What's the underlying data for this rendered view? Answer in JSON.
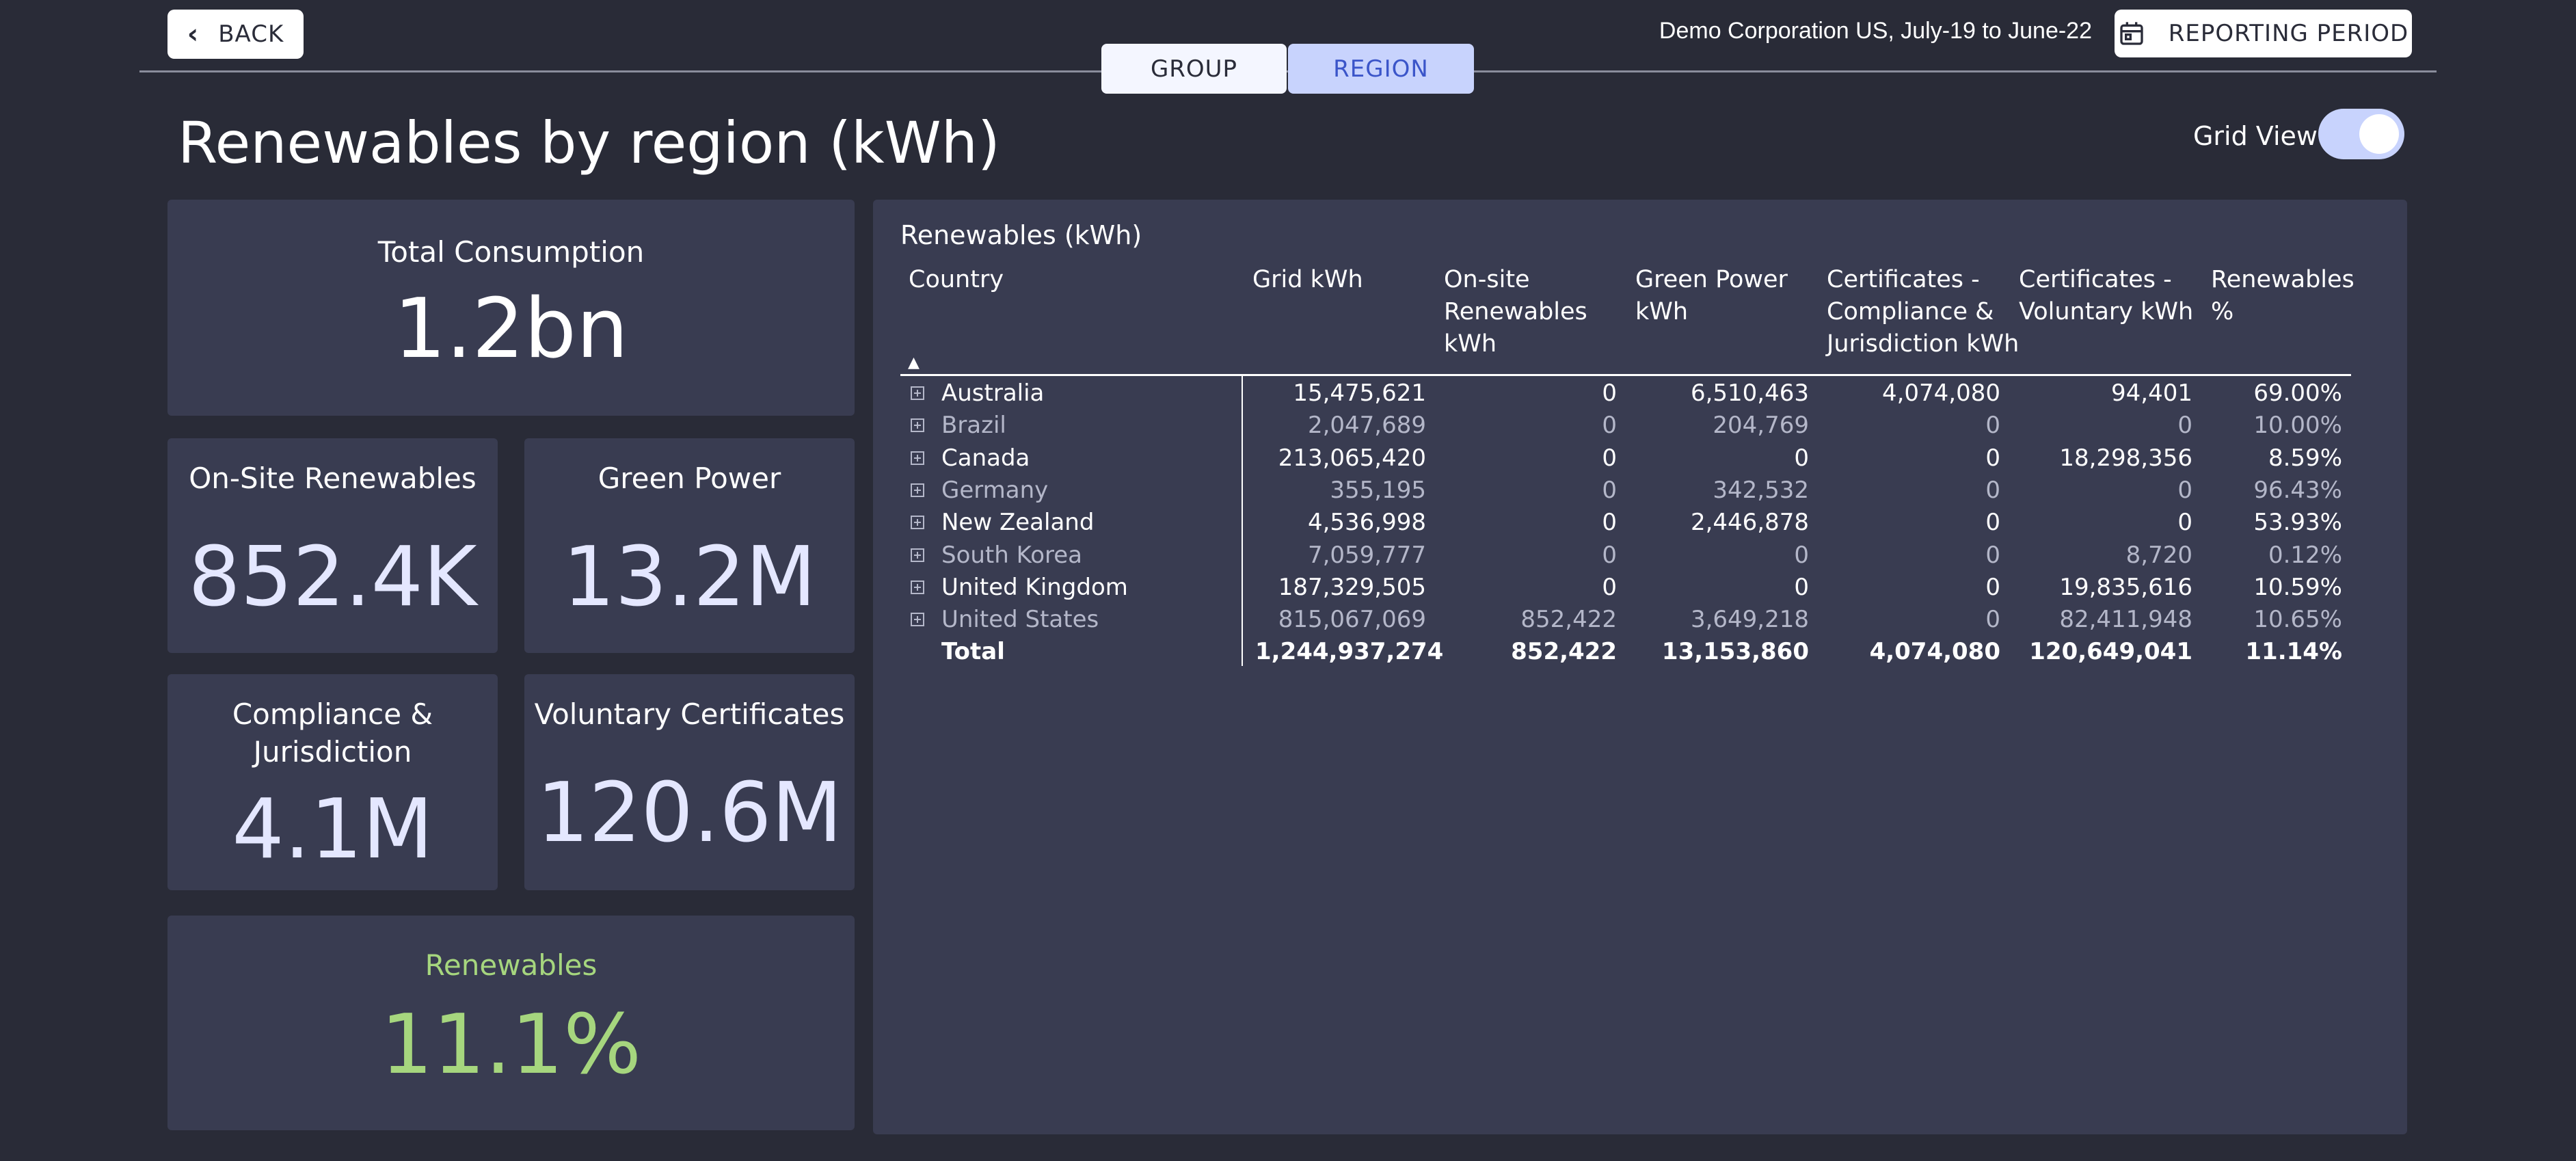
{
  "header": {
    "back_label": "BACK",
    "tabs": [
      {
        "label": "GROUP",
        "selected": false
      },
      {
        "label": "REGION",
        "selected": true
      }
    ],
    "company_period": "Demo Corporation US, July-19 to June-22",
    "reporting_period_label": "REPORTING PERIOD"
  },
  "page": {
    "title": "Renewables by region (kWh)",
    "grid_view_label": "Grid View",
    "grid_view_on": true
  },
  "cards": {
    "total": {
      "label": "Total Consumption",
      "value": "1.2bn"
    },
    "onsite": {
      "label": "On-Site Renewables",
      "value": "852.4K"
    },
    "green": {
      "label": "Green Power",
      "value": "13.2M"
    },
    "compliance": {
      "label_line1": "Compliance &",
      "label_line2": "Jurisdiction",
      "value": "4.1M"
    },
    "voluntary": {
      "label": "Voluntary Certificates",
      "value": "120.6M"
    },
    "renewables": {
      "label": "Renewables",
      "value": "11.1%",
      "accent": "#a6d67e"
    }
  },
  "table": {
    "title": "Renewables (kWh)",
    "sort_indicator": "▲",
    "columns": [
      {
        "line1": "Country",
        "line2": "",
        "line3": ""
      },
      {
        "line1": "Grid kWh",
        "line2": "",
        "line3": ""
      },
      {
        "line1": "On-site",
        "line2": "Renewables",
        "line3": "kWh"
      },
      {
        "line1": "Green Power",
        "line2": "kWh",
        "line3": ""
      },
      {
        "line1": "Certificates -",
        "line2": "Compliance &",
        "line3": "Jurisdiction kWh"
      },
      {
        "line1": "Certificates -",
        "line2": "Voluntary kWh",
        "line3": ""
      },
      {
        "line1": "Renewables",
        "line2": "%",
        "line3": ""
      }
    ],
    "rows": [
      {
        "country": "Australia",
        "grid": "15,475,621",
        "onsite": "0",
        "green": "6,510,463",
        "compliance": "4,074,080",
        "voluntary": "94,401",
        "pct": "69.00%"
      },
      {
        "country": "Brazil",
        "grid": "2,047,689",
        "onsite": "0",
        "green": "204,769",
        "compliance": "0",
        "voluntary": "0",
        "pct": "10.00%"
      },
      {
        "country": "Canada",
        "grid": "213,065,420",
        "onsite": "0",
        "green": "0",
        "compliance": "0",
        "voluntary": "18,298,356",
        "pct": "8.59%"
      },
      {
        "country": "Germany",
        "grid": "355,195",
        "onsite": "0",
        "green": "342,532",
        "compliance": "0",
        "voluntary": "0",
        "pct": "96.43%"
      },
      {
        "country": "New Zealand",
        "grid": "4,536,998",
        "onsite": "0",
        "green": "2,446,878",
        "compliance": "0",
        "voluntary": "0",
        "pct": "53.93%"
      },
      {
        "country": "South Korea",
        "grid": "7,059,777",
        "onsite": "0",
        "green": "0",
        "compliance": "0",
        "voluntary": "8,720",
        "pct": "0.12%"
      },
      {
        "country": "United Kingdom",
        "grid": "187,329,505",
        "onsite": "0",
        "green": "0",
        "compliance": "0",
        "voluntary": "19,835,616",
        "pct": "10.59%"
      },
      {
        "country": "United States",
        "grid": "815,067,069",
        "onsite": "852,422",
        "green": "3,649,218",
        "compliance": "0",
        "voluntary": "82,411,948",
        "pct": "10.65%"
      }
    ],
    "total": {
      "country": "Total",
      "grid": "1,244,937,274",
      "onsite": "852,422",
      "green": "13,153,860",
      "compliance": "4,074,080",
      "voluntary": "120,649,041",
      "pct": "11.14%"
    }
  }
}
